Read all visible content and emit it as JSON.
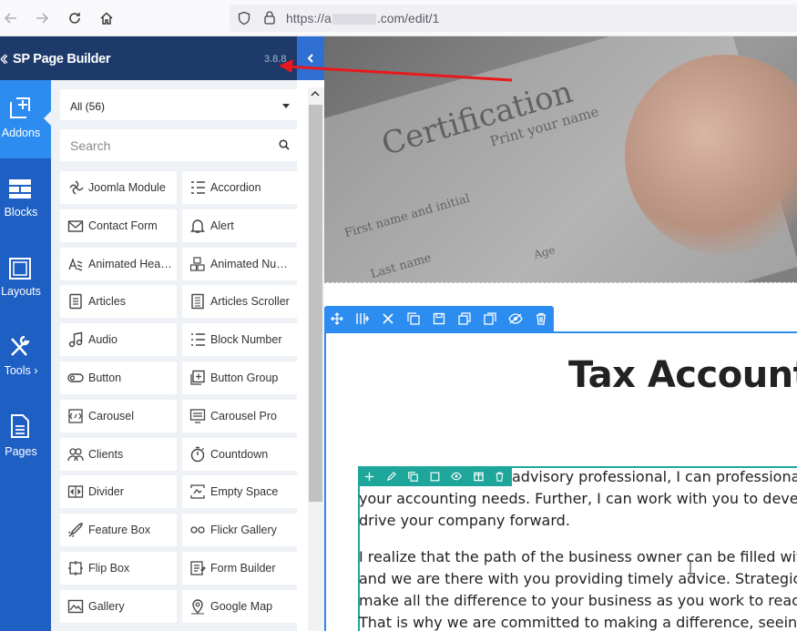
{
  "browser": {
    "url_prefix": "https://a",
    "url_suffix": ".com/edit/1"
  },
  "sidebar": {
    "title": "SP Page Builder",
    "version": "3.8.8",
    "rail": [
      {
        "label": "Addons",
        "icon": "add-square-icon",
        "active": true
      },
      {
        "label": "Blocks",
        "icon": "blocks-icon",
        "active": false
      },
      {
        "label": "Layouts",
        "icon": "layouts-icon",
        "active": false
      },
      {
        "label": "Tools ›",
        "icon": "tools-icon",
        "active": false
      },
      {
        "label": "Pages",
        "icon": "pages-icon",
        "active": false
      }
    ]
  },
  "addons": {
    "filter_value": "All (56)",
    "search_placeholder": "Search",
    "items": [
      {
        "label": "Joomla Module",
        "icon": "joomla-icon"
      },
      {
        "label": "Accordion",
        "icon": "accordion-icon"
      },
      {
        "label": "Contact Form",
        "icon": "envelope-icon"
      },
      {
        "label": "Alert",
        "icon": "bell-icon"
      },
      {
        "label": "Animated Heading",
        "icon": "animated-heading-icon"
      },
      {
        "label": "Animated Number",
        "icon": "animated-number-icon"
      },
      {
        "label": "Articles",
        "icon": "articles-icon"
      },
      {
        "label": "Articles Scroller",
        "icon": "articles-scroller-icon"
      },
      {
        "label": "Audio",
        "icon": "music-note-icon"
      },
      {
        "label": "Block Number",
        "icon": "numbered-list-icon"
      },
      {
        "label": "Button",
        "icon": "button-icon"
      },
      {
        "label": "Button Group",
        "icon": "button-group-icon"
      },
      {
        "label": "Carousel",
        "icon": "carousel-icon"
      },
      {
        "label": "Carousel Pro",
        "icon": "carousel-pro-icon"
      },
      {
        "label": "Clients",
        "icon": "clients-icon"
      },
      {
        "label": "Countdown",
        "icon": "stopwatch-icon"
      },
      {
        "label": "Divider",
        "icon": "divider-icon"
      },
      {
        "label": "Empty Space",
        "icon": "empty-space-icon"
      },
      {
        "label": "Feature Box",
        "icon": "rocket-icon"
      },
      {
        "label": "Flickr Gallery",
        "icon": "flickr-icon"
      },
      {
        "label": "Flip Box",
        "icon": "flip-box-icon"
      },
      {
        "label": "Form Builder",
        "icon": "form-builder-icon"
      },
      {
        "label": "Gallery",
        "icon": "image-icon"
      },
      {
        "label": "Google Map",
        "icon": "map-pin-icon"
      }
    ]
  },
  "canvas": {
    "hero_text_1": "Certification",
    "hero_text_2": "Print your name",
    "hero_text_3": "First name and initial",
    "hero_text_4": "Last name",
    "hero_text_5": "Age",
    "heading": "Tax Account",
    "para1": [
      "advisory professional, I can professionall",
      "your accounting needs. Further, I can work with you to develo",
      "drive your company forward."
    ],
    "para2": [
      "I realize that the path of the business owner can be filled with",
      "and we are there with you providing timely advice. Strategic",
      "make all the difference to your business as you work to reach",
      "That is why we are committed to making a difference, seeing"
    ]
  },
  "colors": {
    "header": "#1d3a6a",
    "rail": "#1e5fc4",
    "rail_active": "#2d8cf0",
    "toolbar": "#2d8cf0",
    "inner_toolbar": "#1fa69a",
    "annotation_arrow": "#e8191d"
  }
}
